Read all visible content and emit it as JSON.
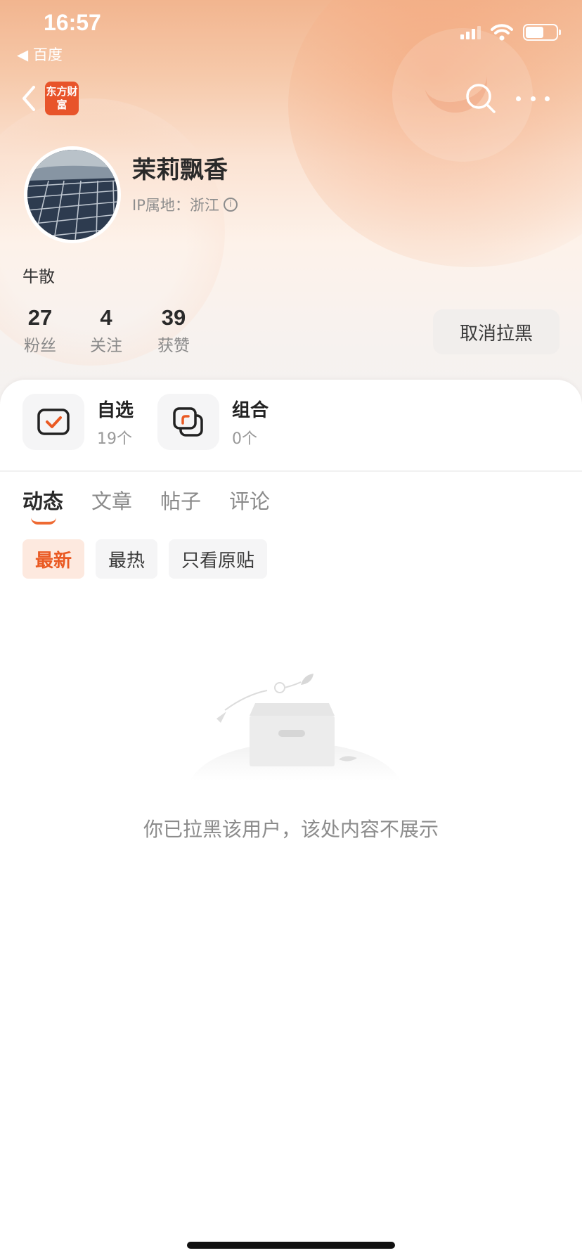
{
  "status": {
    "time": "16:57",
    "back_app": "◀ 百度"
  },
  "nav": {
    "logo_text": "东方财富"
  },
  "profile": {
    "name": "茉莉飘香",
    "ip_location": "IP属地：浙江",
    "bio": "牛散",
    "stats": [
      {
        "value": "27",
        "label": "粉丝"
      },
      {
        "value": "4",
        "label": "关注"
      },
      {
        "value": "39",
        "label": "获赞"
      }
    ],
    "unblock_button": "取消拉黑"
  },
  "assets": [
    {
      "title": "自选",
      "count": "19个"
    },
    {
      "title": "组合",
      "count": "0个"
    }
  ],
  "tabs": [
    {
      "label": "动态",
      "active": true
    },
    {
      "label": "文章",
      "active": false
    },
    {
      "label": "帖子",
      "active": false
    },
    {
      "label": "评论",
      "active": false
    }
  ],
  "filters": [
    {
      "label": "最新",
      "active": true
    },
    {
      "label": "最热",
      "active": false
    },
    {
      "label": "只看原贴",
      "active": false
    }
  ],
  "empty_message": "你已拉黑该用户，该处内容不展示",
  "colors": {
    "accent": "#ea5a23",
    "header_gradient_top": "#f2b58f"
  }
}
